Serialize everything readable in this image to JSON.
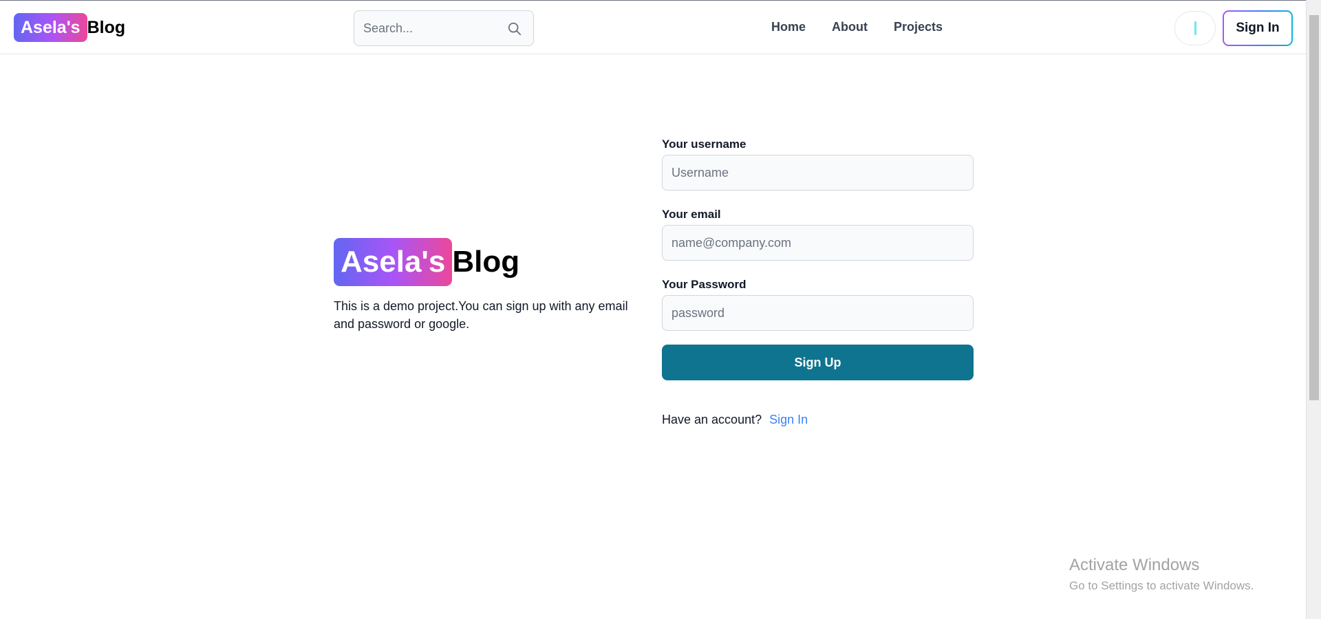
{
  "header": {
    "logo": {
      "badge": "Asela's",
      "text": "Blog"
    },
    "search": {
      "placeholder": "Search...",
      "icon": "search-icon"
    },
    "nav": [
      "Home",
      "About",
      "Projects"
    ],
    "theme_toggle_icon": "toggle-icon",
    "signin_label": "Sign In"
  },
  "hero": {
    "logo": {
      "badge": "Asela's",
      "text": "Blog"
    },
    "description": "This is a demo project.You can sign up with any email and password or google."
  },
  "form": {
    "username": {
      "label": "Your username",
      "placeholder": "Username"
    },
    "email": {
      "label": "Your email",
      "placeholder": "name@company.com"
    },
    "password": {
      "label": "Your Password",
      "placeholder": "password"
    },
    "submit_label": "Sign Up",
    "have_account": "Have an account?",
    "signin_link": "Sign In"
  },
  "watermark": {
    "title": "Activate Windows",
    "subtitle": "Go to Settings to activate Windows."
  },
  "colors": {
    "accent": "#0e7490",
    "link": "#3b82f6",
    "gradient_start": "#6366f1",
    "gradient_end": "#ec4899"
  }
}
